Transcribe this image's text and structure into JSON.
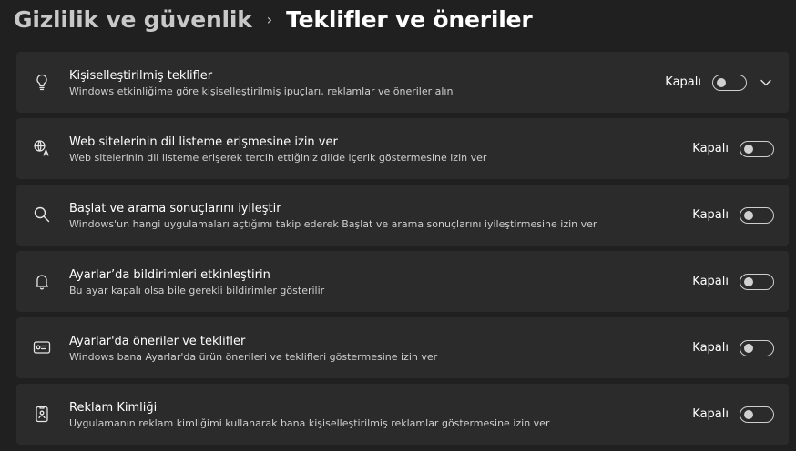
{
  "breadcrumb": {
    "parent": "Gizlilik ve güvenlik",
    "separator": "›",
    "current": "Teklifler ve öneriler"
  },
  "settings": [
    {
      "icon": "lightbulb-icon",
      "title": "Kişiselleştirilmiş teklifler",
      "description": "Windows etkinliğime göre kişiselleştirilmiş ipuçları, reklamlar ve öneriler alın",
      "state": "Kapalı",
      "on": false,
      "expandable": true
    },
    {
      "icon": "language-globe-icon",
      "title": "Web sitelerinin dil listeme erişmesine izin ver",
      "description": "Web sitelerinin dil listeme erişerek tercih ettiğiniz dilde içerik göstermesine izin ver",
      "state": "Kapalı",
      "on": false,
      "expandable": false
    },
    {
      "icon": "search-icon",
      "title": "Başlat ve arama sonuçlarını iyileştir",
      "description": "Windows'un hangi uygulamaları açtığımı takip ederek Başlat ve arama sonuçlarını iyileştirmesine izin ver",
      "state": "Kapalı",
      "on": false,
      "expandable": false
    },
    {
      "icon": "bell-icon",
      "title": "Ayarlar’da bildirimleri etkinleştirin",
      "description": "Bu ayar kapalı olsa bile gerekli bildirimler gösterilir",
      "state": "Kapalı",
      "on": false,
      "expandable": false
    },
    {
      "icon": "settings-card-icon",
      "title": "Ayarlar'da öneriler ve teklifler",
      "description": "Windows bana Ayarlar'da ürün önerileri ve teklifleri göstermesine izin ver",
      "state": "Kapalı",
      "on": false,
      "expandable": false
    },
    {
      "icon": "id-badge-icon",
      "title": "Reklam Kimliği",
      "description": "Uygulamanın reklam kimliğimi kullanarak bana kişiselleştirilmiş reklamlar göstermesine izin ver",
      "state": "Kapalı",
      "on": false,
      "expandable": false
    }
  ]
}
